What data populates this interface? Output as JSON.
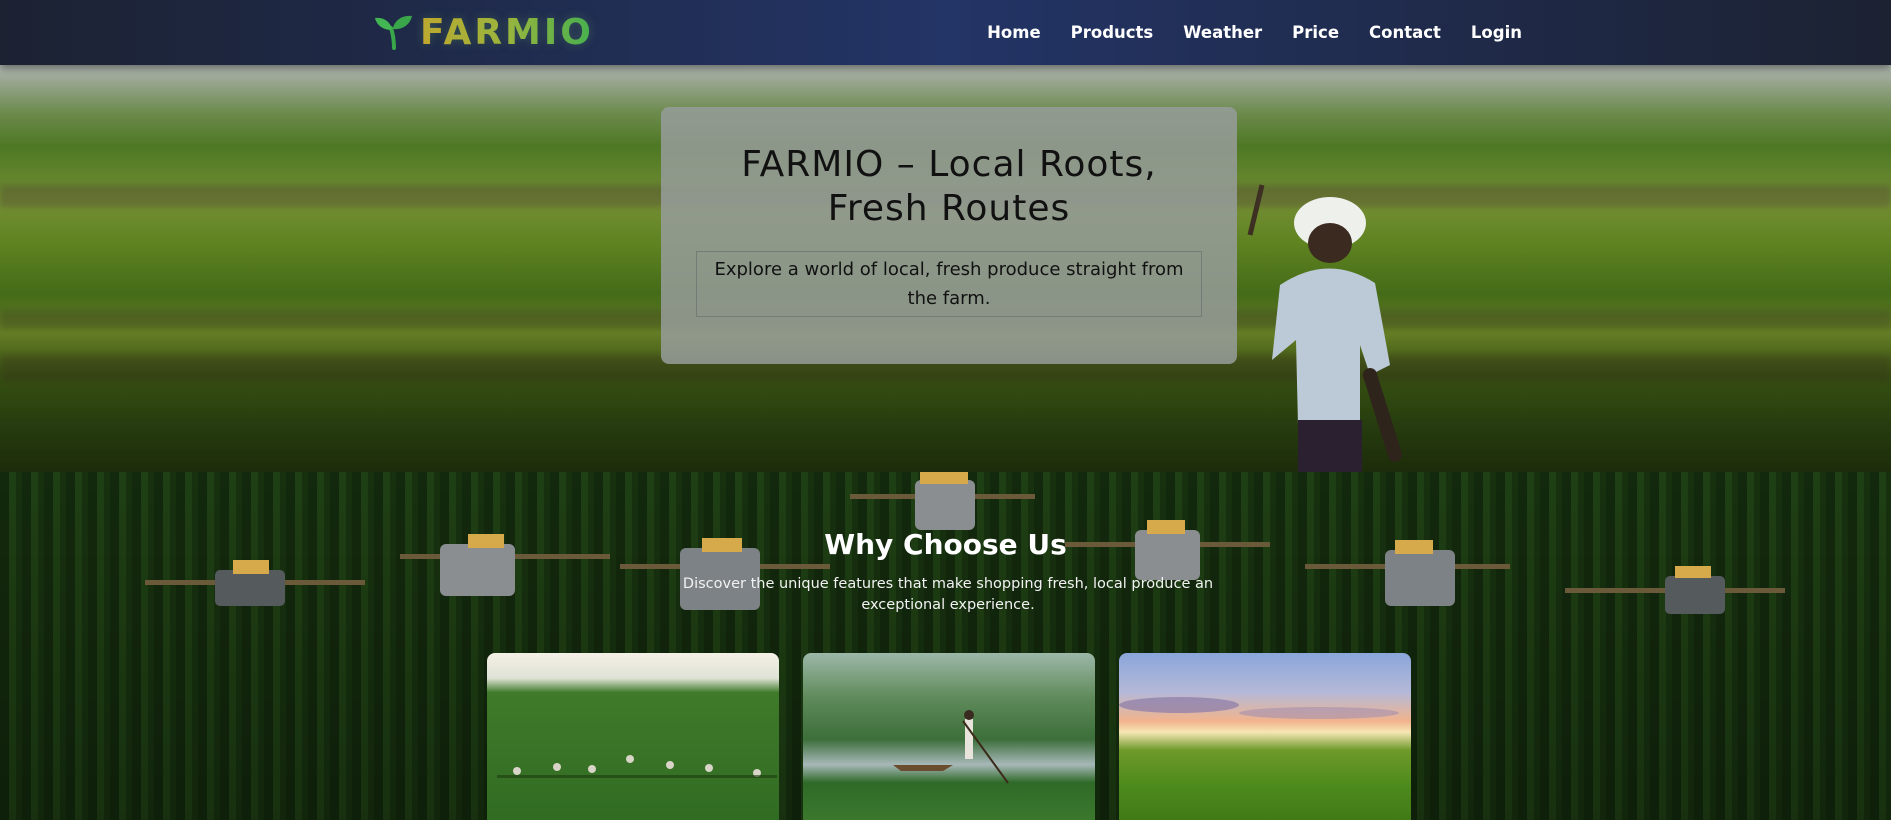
{
  "brand": {
    "name": "FARMIO",
    "icon": "sprout-icon"
  },
  "nav": {
    "items": [
      {
        "label": "Home"
      },
      {
        "label": "Products"
      },
      {
        "label": "Weather"
      },
      {
        "label": "Price"
      },
      {
        "label": "Contact"
      },
      {
        "label": "Login"
      }
    ]
  },
  "hero": {
    "title": "FARMIO – Local Roots, Fresh Routes",
    "subtitle": "Explore a world of local, fresh produce straight from the farm."
  },
  "why": {
    "title": "Why Choose Us",
    "subtitle": "Discover the unique features that make shopping fresh, local produce an exceptional experience."
  },
  "colors": {
    "nav_bg": "#233466",
    "brand_gold": "#c8a42a",
    "brand_green": "#3fae4f",
    "hero_card": "#969c9a"
  }
}
